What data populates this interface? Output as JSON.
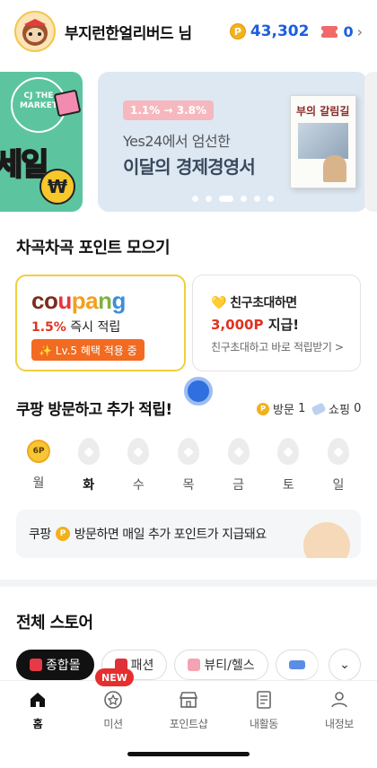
{
  "header": {
    "username": "부지런한얼리버드 님",
    "point_symbol": "P",
    "points": "43,302",
    "tickets": "0",
    "chevron": "›"
  },
  "banner": {
    "left_logo": "CJ THE MARKET",
    "left_text": "세일",
    "left_coin": "₩",
    "badge": "1.1% → 3.8%",
    "subtitle": "Yes24에서 엄선한",
    "title": "이달의 경제경영서",
    "book_title": "부의 갈림길",
    "active_dot": 2
  },
  "points_section": {
    "title": "차곡차곡 포인트 모으기",
    "coupang": {
      "logo": "coupang",
      "logo_colors": [
        "#7b2d1c",
        "#7b2d1c",
        "#e9343c",
        "#f3a01c",
        "#f3a01c",
        "#7fb241",
        "#3c8fd8",
        "#3c8fd8"
      ],
      "rate": "1.5%",
      "rate_suffix": "즉시 적립",
      "level_button": "✨ Lv.5 혜택 적용 중"
    },
    "friend": {
      "title": "💛 친구초대하면",
      "point": "3,000P",
      "point_suffix": "지급!",
      "link": "친구초대하고 바로 적립받기 >"
    }
  },
  "visit": {
    "title": "쿠팡 방문하고 추가 적립!",
    "visit_label": "방문",
    "visit_count": "1",
    "shop_label": "쇼핑",
    "shop_count": "0",
    "days": [
      {
        "label": "월",
        "reward": "6P",
        "got": true,
        "today": false
      },
      {
        "label": "화",
        "reward": "",
        "got": false,
        "today": true
      },
      {
        "label": "수",
        "reward": "",
        "got": false,
        "today": false
      },
      {
        "label": "목",
        "reward": "",
        "got": false,
        "today": false
      },
      {
        "label": "금",
        "reward": "",
        "got": false,
        "today": false
      },
      {
        "label": "토",
        "reward": "",
        "got": false,
        "today": false
      },
      {
        "label": "일",
        "reward": "",
        "got": false,
        "today": false
      }
    ],
    "notice_prefix": "쿠팡",
    "notice_suffix": "방문하면 매일 추가 포인트가 지급돼요"
  },
  "store": {
    "title": "전체 스토어",
    "chips": [
      {
        "label": "종합몰",
        "icon": "shopping-bag-icon",
        "color": "#e63946",
        "active": true
      },
      {
        "label": "패션",
        "icon": "dress-icon",
        "color": "#e0303a",
        "active": false
      },
      {
        "label": "뷰티/헬스",
        "icon": "cosmetic-bottle-icon",
        "color": "#f4a3b3",
        "active": false
      },
      {
        "label": "",
        "icon": "airplane-icon",
        "color": "#5b8de6",
        "active": false
      }
    ],
    "more": "⌄"
  },
  "bottom_nav": {
    "new_badge": "NEW",
    "items": [
      {
        "label": "홈",
        "icon": "home-icon",
        "active": true
      },
      {
        "label": "미션",
        "icon": "mission-medal-icon",
        "active": false
      },
      {
        "label": "포인트샵",
        "icon": "store-icon",
        "active": false
      },
      {
        "label": "내활동",
        "icon": "activity-receipt-icon",
        "active": false
      },
      {
        "label": "내정보",
        "icon": "profile-icon",
        "active": false
      }
    ]
  },
  "colors": {
    "accent_blue": "#1d5de0",
    "coin_gold": "#f2b21b",
    "highlight_red": "#e0331f",
    "coupang_border": "#f0cf3e",
    "level_orange": "#f26b21"
  }
}
